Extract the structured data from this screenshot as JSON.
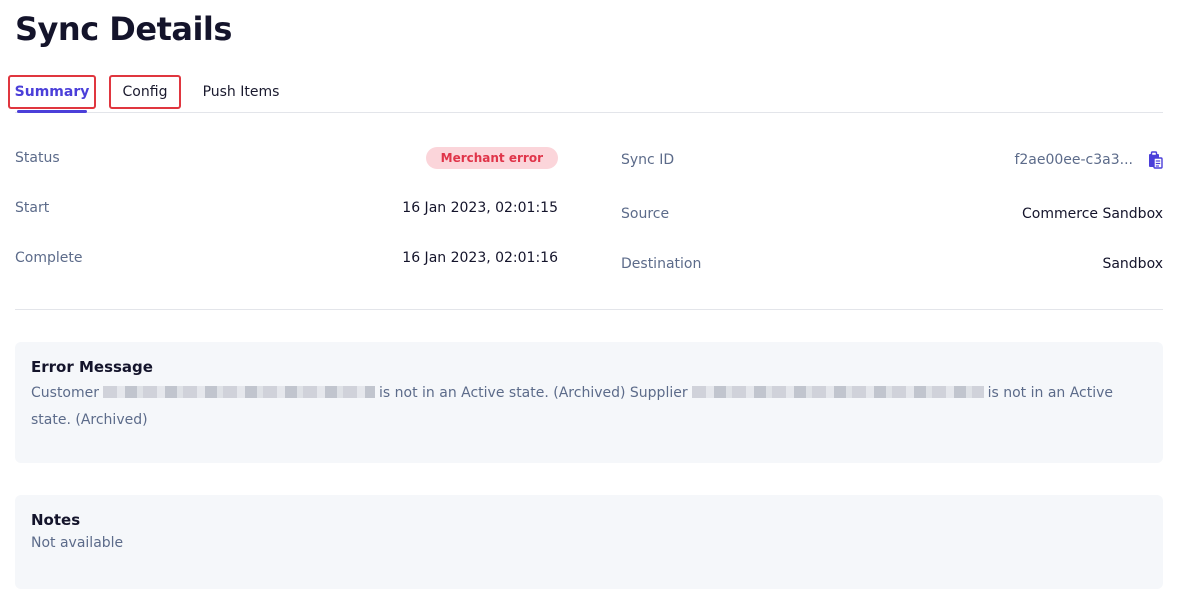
{
  "page": {
    "title": "Sync Details"
  },
  "tabs": [
    {
      "label": "Summary",
      "active": true
    },
    {
      "label": "Config",
      "active": false
    },
    {
      "label": "Push Items",
      "active": false
    }
  ],
  "details": {
    "status_label": "Status",
    "status_value": "Merchant error",
    "start_label": "Start",
    "start_value": "16 Jan 2023, 02:01:15",
    "complete_label": "Complete",
    "complete_value": "16 Jan 2023, 02:01:16",
    "sync_id_label": "Sync ID",
    "sync_id_value": "f2ae00ee-c3a3...",
    "source_label": "Source",
    "source_value": "Commerce Sandbox",
    "destination_label": "Destination",
    "destination_value": "Sandbox"
  },
  "error": {
    "title": "Error Message",
    "part1": "Customer",
    "part2": "is not in an Active state. (Archived) Supplier",
    "part3": "is not in an Active state. (Archived)"
  },
  "notes": {
    "title": "Notes",
    "body": "Not available"
  },
  "colors": {
    "accent": "#4b3fd9",
    "badge_bg": "#fbd5da",
    "badge_text": "#e0354a",
    "highlight_border": "#e0363f",
    "card_bg": "#f5f7fa"
  },
  "icons": {
    "copy": "copy-clipboard-icon"
  }
}
